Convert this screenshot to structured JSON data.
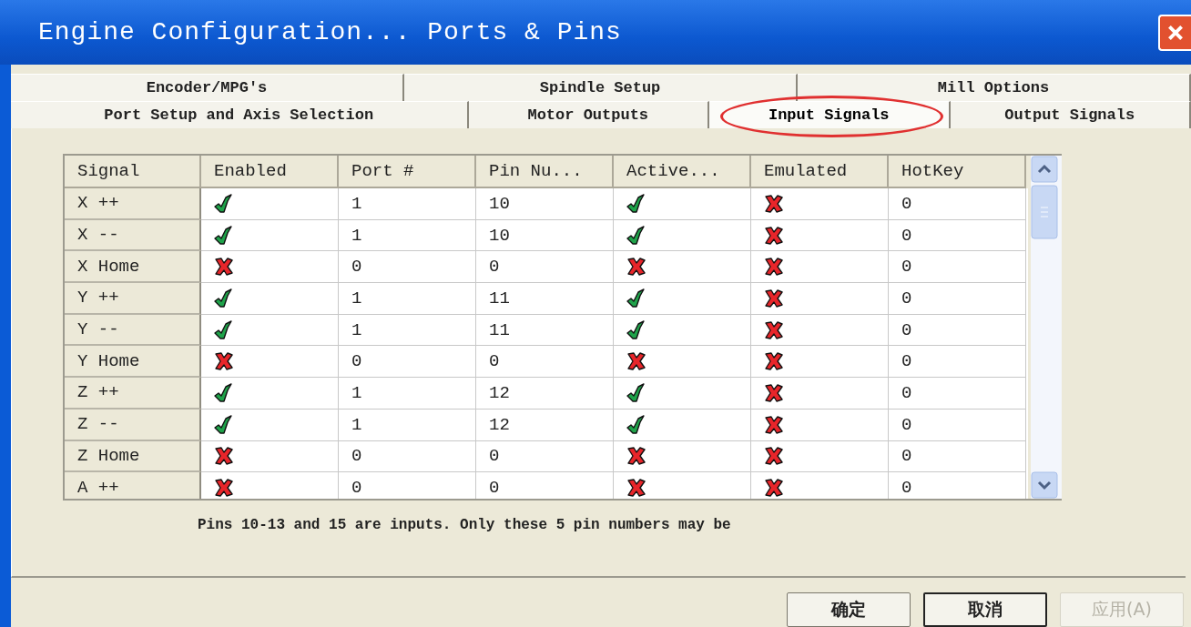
{
  "window": {
    "title": "Engine Configuration... Ports & Pins"
  },
  "tab_rows": [
    {
      "tabs": [
        {
          "label": "Encoder/MPG's",
          "selected": false,
          "circled": false
        },
        {
          "label": "Spindle Setup",
          "selected": false,
          "circled": false
        },
        {
          "label": "Mill Options",
          "selected": false,
          "circled": false
        }
      ]
    },
    {
      "tabs": [
        {
          "label": "Port Setup and Axis Selection",
          "selected": false,
          "circled": false
        },
        {
          "label": "Motor Outputs",
          "selected": false,
          "circled": false
        },
        {
          "label": "Input Signals",
          "selected": true,
          "circled": true
        },
        {
          "label": "Output Signals",
          "selected": false,
          "circled": false
        }
      ]
    }
  ],
  "table": {
    "columns": [
      "Signal",
      "Enabled",
      "Port #",
      "Pin Nu...",
      "Active...",
      "Emulated",
      "HotKey"
    ],
    "rows": [
      {
        "signal": "X ++",
        "enabled": true,
        "port": "1",
        "pin": "10",
        "active": true,
        "emulated": false,
        "hotkey": "0"
      },
      {
        "signal": "X --",
        "enabled": true,
        "port": "1",
        "pin": "10",
        "active": true,
        "emulated": false,
        "hotkey": "0"
      },
      {
        "signal": "X Home",
        "enabled": false,
        "port": "0",
        "pin": "0",
        "active": false,
        "emulated": false,
        "hotkey": "0"
      },
      {
        "signal": "Y ++",
        "enabled": true,
        "port": "1",
        "pin": "11",
        "active": true,
        "emulated": false,
        "hotkey": "0"
      },
      {
        "signal": "Y --",
        "enabled": true,
        "port": "1",
        "pin": "11",
        "active": true,
        "emulated": false,
        "hotkey": "0"
      },
      {
        "signal": "Y Home",
        "enabled": false,
        "port": "0",
        "pin": "0",
        "active": false,
        "emulated": false,
        "hotkey": "0"
      },
      {
        "signal": "Z ++",
        "enabled": true,
        "port": "1",
        "pin": "12",
        "active": true,
        "emulated": false,
        "hotkey": "0"
      },
      {
        "signal": "Z --",
        "enabled": true,
        "port": "1",
        "pin": "12",
        "active": true,
        "emulated": false,
        "hotkey": "0"
      },
      {
        "signal": "Z Home",
        "enabled": false,
        "port": "0",
        "pin": "0",
        "active": false,
        "emulated": false,
        "hotkey": "0"
      },
      {
        "signal": "A ++",
        "enabled": false,
        "port": "0",
        "pin": "0",
        "active": false,
        "emulated": false,
        "hotkey": "0"
      }
    ]
  },
  "note": "Pins 10-13 and 15 are inputs. Only these 5 pin numbers may be",
  "buttons": [
    {
      "label": "确定",
      "disabled": false,
      "focused": false
    },
    {
      "label": "取消",
      "disabled": false,
      "focused": true
    },
    {
      "label": "应用(A)",
      "disabled": true,
      "focused": false
    }
  ]
}
